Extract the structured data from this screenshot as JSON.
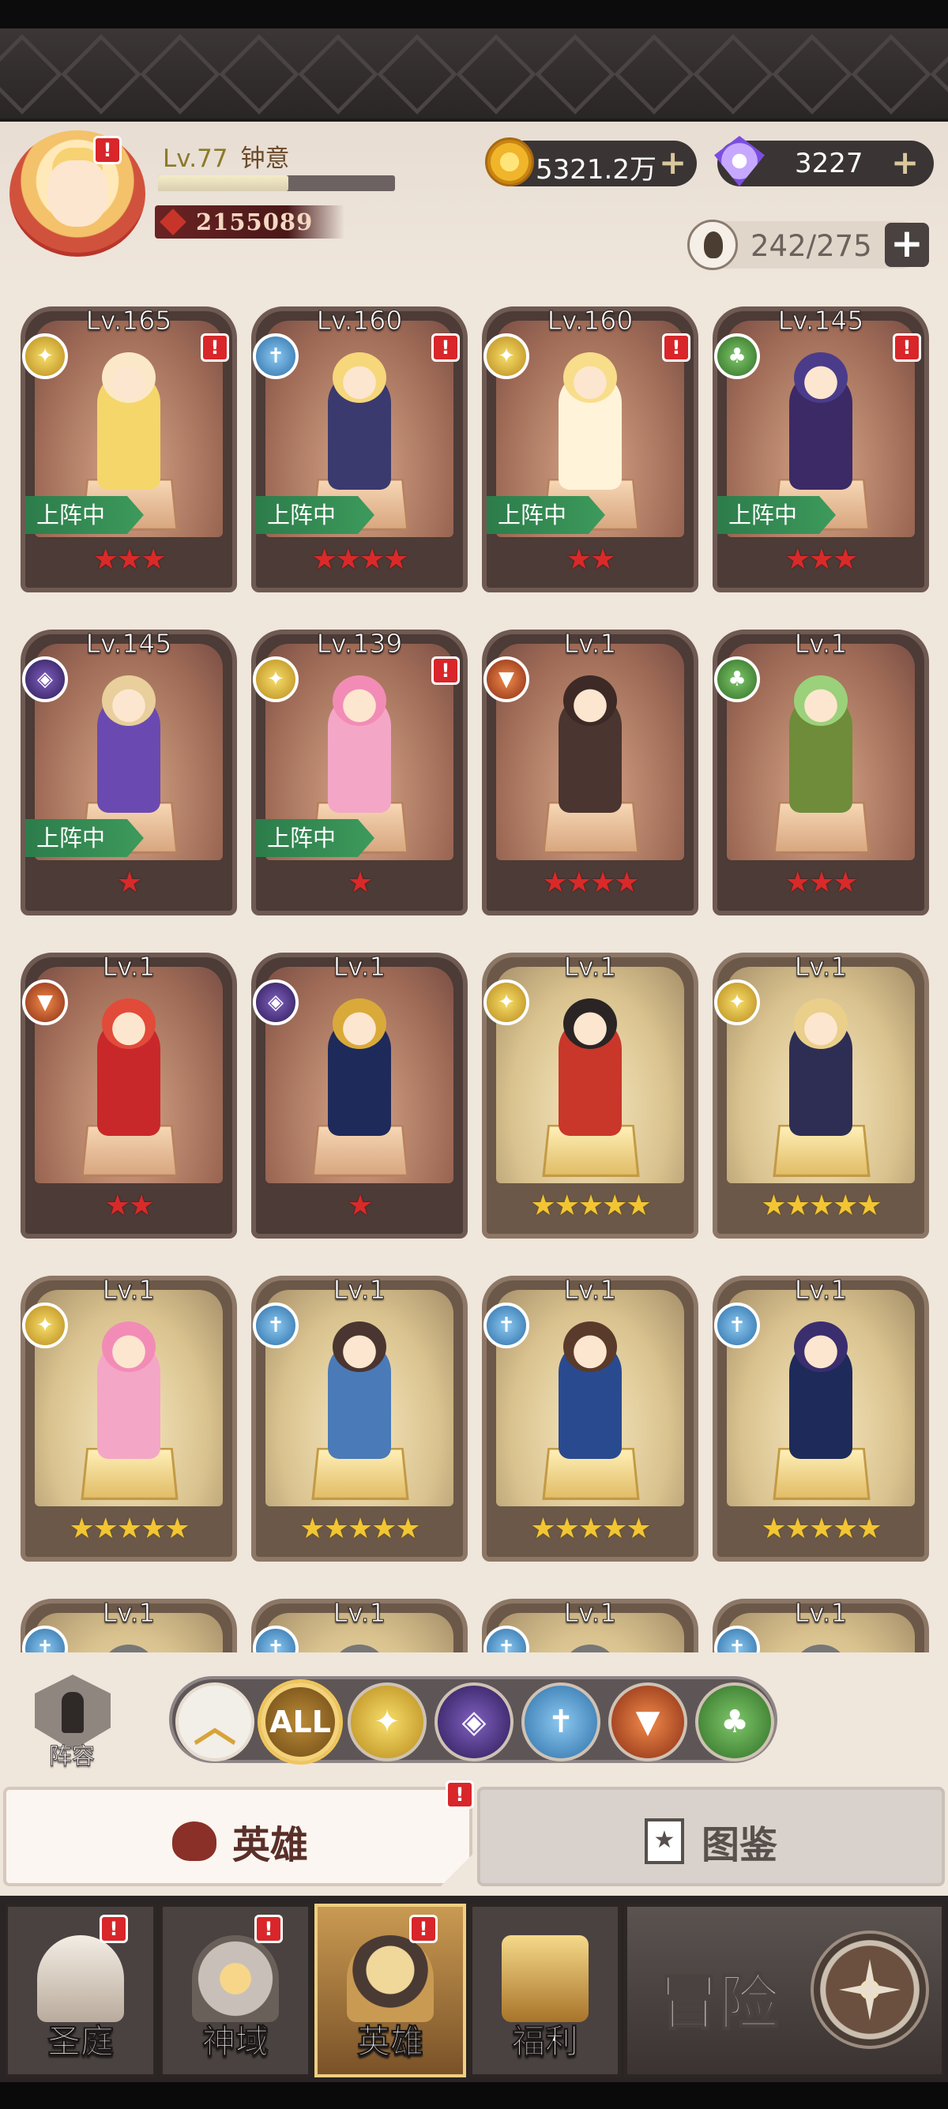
{
  "player": {
    "level_label": "Lv.77",
    "name": "钟意",
    "power": "2155089",
    "exp_fraction": 0.55
  },
  "resources": {
    "gold": "5321.2万",
    "diamonds": "3227",
    "hero_capacity": "242/275",
    "plus_symbol": "+"
  },
  "alert_symbol": "!",
  "heroes": [
    {
      "level": "Lv.165",
      "faction": "light-icon",
      "deployed": true,
      "deploy_label": "上阵中",
      "stars": "★★★",
      "star_color": "red",
      "alert": true
    },
    {
      "level": "Lv.160",
      "faction": "holy-icon",
      "deployed": true,
      "deploy_label": "上阵中",
      "stars": "★★★★",
      "star_color": "red",
      "alert": true
    },
    {
      "level": "Lv.160",
      "faction": "light-icon",
      "deployed": true,
      "deploy_label": "上阵中",
      "stars": "★★",
      "star_color": "red",
      "alert": true
    },
    {
      "level": "Lv.145",
      "faction": "nature-icon",
      "deployed": true,
      "deploy_label": "上阵中",
      "stars": "★★★",
      "star_color": "red",
      "alert": true
    },
    {
      "level": "Lv.145",
      "faction": "dark-icon",
      "deployed": true,
      "deploy_label": "上阵中",
      "stars": "★",
      "star_color": "red",
      "alert": false
    },
    {
      "level": "Lv.139",
      "faction": "light-icon",
      "deployed": true,
      "deploy_label": "上阵中",
      "stars": "★",
      "star_color": "red",
      "alert": true
    },
    {
      "level": "Lv.1",
      "faction": "beast-icon",
      "deployed": false,
      "stars": "★★★★",
      "star_color": "red",
      "alert": false
    },
    {
      "level": "Lv.1",
      "faction": "nature-icon",
      "deployed": false,
      "stars": "★★★",
      "star_color": "red",
      "alert": false
    },
    {
      "level": "Lv.1",
      "faction": "beast-icon",
      "deployed": false,
      "stars": "★★",
      "star_color": "red",
      "alert": false
    },
    {
      "level": "Lv.1",
      "faction": "dark-icon",
      "deployed": false,
      "stars": "★",
      "star_color": "red",
      "alert": false
    },
    {
      "level": "Lv.1",
      "faction": "light-icon",
      "deployed": false,
      "stars": "★★★★★",
      "star_color": "gold",
      "alert": false
    },
    {
      "level": "Lv.1",
      "faction": "light-icon",
      "deployed": false,
      "stars": "★★★★★",
      "star_color": "gold",
      "alert": false
    },
    {
      "level": "Lv.1",
      "faction": "light-icon",
      "deployed": false,
      "stars": "★★★★★",
      "star_color": "gold",
      "alert": false
    },
    {
      "level": "Lv.1",
      "faction": "holy-icon",
      "deployed": false,
      "stars": "★★★★★",
      "star_color": "gold",
      "alert": false
    },
    {
      "level": "Lv.1",
      "faction": "holy-icon",
      "deployed": false,
      "stars": "★★★★★",
      "star_color": "gold",
      "alert": false
    },
    {
      "level": "Lv.1",
      "faction": "holy-icon",
      "deployed": false,
      "stars": "★★★★★",
      "star_color": "gold",
      "alert": false
    },
    {
      "level": "Lv.1",
      "faction": "holy-icon",
      "deployed": false,
      "stars": "",
      "star_color": "gold",
      "alert": false
    },
    {
      "level": "Lv.1",
      "faction": "holy-icon",
      "deployed": false,
      "stars": "",
      "star_color": "gold",
      "alert": false
    },
    {
      "level": "Lv.1",
      "faction": "holy-icon",
      "deployed": false,
      "stars": "",
      "star_color": "gold",
      "alert": false
    },
    {
      "level": "Lv.1",
      "faction": "holy-icon",
      "deployed": false,
      "stars": "",
      "star_color": "gold",
      "alert": false
    }
  ],
  "filter": {
    "lineup_label": "阵容",
    "all_label": "ALL",
    "buttons": [
      "collapse-icon",
      "all",
      "light-icon",
      "dark-icon",
      "holy-icon",
      "beast-icon",
      "nature-icon"
    ],
    "selected": "all"
  },
  "tabs": {
    "heroes": "英雄",
    "codex": "图鉴",
    "codex_icon_glyph": "★"
  },
  "nav": [
    {
      "label": "圣庭",
      "icon": "court-icon",
      "alert": true
    },
    {
      "label": "神域",
      "icon": "divine-realm-icon",
      "alert": true
    },
    {
      "label": "英雄",
      "icon": "hero-helmet-icon",
      "alert": true,
      "active": true
    },
    {
      "label": "福利",
      "icon": "treasure-chest-icon",
      "alert": false
    }
  ],
  "adventure_label": "冒险",
  "colors": {
    "star_red": "#d92a2a",
    "star_gold": "#f2c534",
    "deploy_green": "#2c7c4a",
    "alert_red": "#d8262a"
  }
}
